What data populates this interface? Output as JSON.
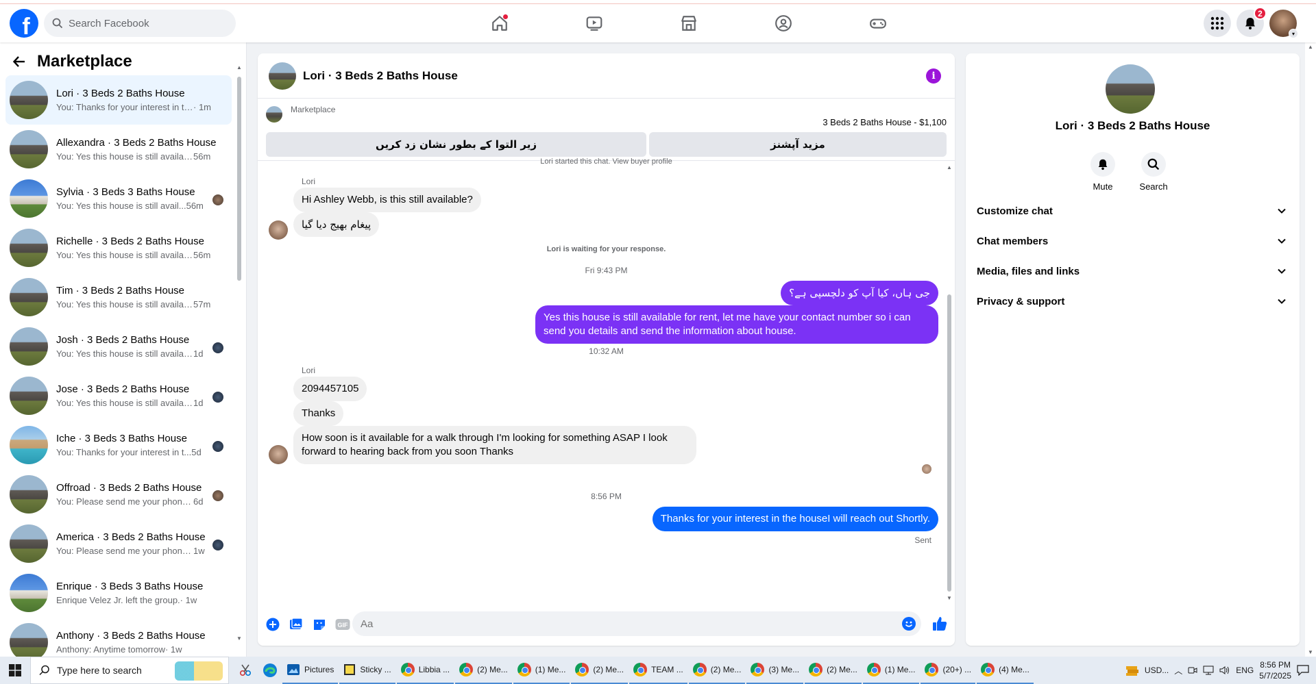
{
  "topbar": {
    "search_placeholder": "Search Facebook",
    "notif_count": "2"
  },
  "sidebar": {
    "title": "Marketplace",
    "conversations": [
      {
        "name": "Lori · 3 Beds 2 Baths House",
        "preview": "You: Thanks for your interest in the...",
        "time": "· 1m"
      },
      {
        "name": "Allexandra · 3 Beds 2 Baths House",
        "preview": "You: Yes this house is still availabl...",
        "time": "56m"
      },
      {
        "name": "Sylvia · 3 Beds 3 Baths House",
        "preview": "You: Yes this house is still avail...",
        "time": "56m"
      },
      {
        "name": "Richelle · 3 Beds 2 Baths House",
        "preview": "You: Yes this house is still availabl...",
        "time": "56m"
      },
      {
        "name": "Tim · 3 Beds 2 Baths House",
        "preview": "You: Yes this house is still availabl...",
        "time": "57m"
      },
      {
        "name": "Josh · 3 Beds 2 Baths House",
        "preview": "You: Yes this house is still availab...",
        "time": "1d"
      },
      {
        "name": "Jose · 3 Beds 2 Baths House",
        "preview": "You: Yes this house is still availab...",
        "time": "1d"
      },
      {
        "name": "Iche · 3 Beds 3 Baths House",
        "preview": "You: Thanks for your interest in t...",
        "time": "5d"
      },
      {
        "name": "Offroad · 3 Beds 2 Baths House",
        "preview": "You: Please send me your phone...",
        "time": "6d"
      },
      {
        "name": "America · 3 Beds 2 Baths House",
        "preview": "You: Please send me your phone...",
        "time": "1w"
      },
      {
        "name": "Enrique · 3 Beds 3 Baths House",
        "preview": "Enrique Velez Jr. left the group.",
        "time": "· 1w"
      },
      {
        "name": "Anthony · 3 Beds 2 Baths House",
        "preview": "Anthony: Anytime tomorrow",
        "time": "· 1w"
      }
    ]
  },
  "chat": {
    "title": "Lori · 3 Beds 2 Baths House",
    "marketplace_label": "Marketplace",
    "listing": "3 Beds 2 Baths House - $1,100",
    "btn_mark": "زیر التوا کے بطور نشان زد کریں",
    "btn_more": "مزید آپشنز",
    "started_note": "Lori started this chat. View buyer profile",
    "sender1": "Lori",
    "msg1": "Hi Ashley Webb, is this still available?",
    "msg2": "پیغام بھیج دیا گیا",
    "waiting": "Lori is waiting for your response.",
    "time1": "Fri 9:43 PM",
    "out1": "جی ہاں، کیا آپ کو دلچسپی ہے؟",
    "out2": "Yes this house is still available for rent, let me have your contact number so i can send you details and send the information about house.",
    "time2": "10:32 AM",
    "sender2": "Lori",
    "msg3": "2094457105",
    "msg4": "Thanks",
    "msg5": "How soon is it available for a walk through I'm looking for something ASAP I look forward to hearing back from you soon Thanks",
    "time3": "8:56 PM",
    "out3": "Thanks for your interest in the houseI will reach out Shortly.",
    "sent": "Sent",
    "input_placeholder": "Aa"
  },
  "info_panel": {
    "name": "Lori · 3 Beds 2 Baths House",
    "mute": "Mute",
    "search": "Search",
    "menu": [
      "Customize chat",
      "Chat members",
      "Media, files and links",
      "Privacy & support"
    ]
  },
  "taskbar": {
    "search_placeholder": "Type here to search",
    "tasks": [
      "Pictures",
      "Sticky ...",
      "Libbia ...",
      "(2) Me...",
      "(1) Me...",
      "(2) Me...",
      "TEAM ...",
      "(2) Me...",
      "(3) Me...",
      "(2) Me...",
      "(1) Me...",
      "(20+) ...",
      "(4) Me..."
    ],
    "tray_currency": "USD...",
    "lang": "ENG",
    "time": "8:56 PM",
    "date": "5/7/2025"
  },
  "colors": {
    "accent": "#0866ff",
    "outgoing_purple": "#7b32f5",
    "info_purple": "#9b14d9",
    "badge_red": "#e41e3f"
  }
}
